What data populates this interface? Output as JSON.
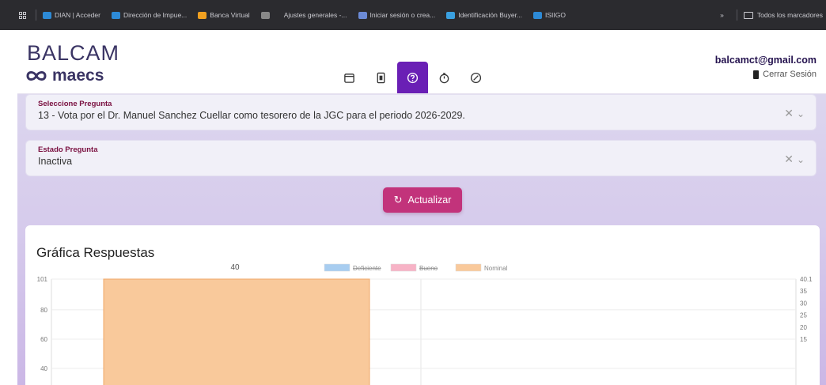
{
  "browser": {
    "bookmarks": [
      {
        "label": "DIAN | Acceder",
        "color": "#2d8ad6"
      },
      {
        "label": "Dirección de Impue...",
        "color": "#2d8ad6"
      },
      {
        "label": "Banca Virtual",
        "color": "#f0a020"
      },
      {
        "label": "",
        "color": "#888888"
      },
      {
        "label": "Ajustes generales -...",
        "color": ""
      },
      {
        "label": "Iniciar sesión o crea...",
        "color": "#6b8ad6"
      },
      {
        "label": "Identificación Buyer...",
        "color": "#3aa0e0"
      },
      {
        "label": "ISIIGO",
        "color": "#2d8ad6"
      }
    ],
    "more_label": "»",
    "all_bookmarks_label": "Todos los marcadores"
  },
  "header": {
    "brand_top": "BALCAM",
    "brand_bottom": "maecs",
    "user_email": "balcamct@gmail.com",
    "logout_label": "Cerrar Sesión",
    "nav_tabs": [
      {
        "icon": "calendar-icon",
        "active": false
      },
      {
        "icon": "document-icon",
        "active": false
      },
      {
        "icon": "question-icon",
        "active": true
      },
      {
        "icon": "timer-icon",
        "active": false
      },
      {
        "icon": "cancel-icon",
        "active": false
      }
    ]
  },
  "form": {
    "question_label": "Seleccione Pregunta",
    "question_value": "13 - Vota por el Dr. Manuel Sanchez Cuellar como tesorero de la JGC para el periodo 2026-2029.",
    "status_label": "Estado Pregunta",
    "status_value": "Inactiva",
    "refresh_label": "Actualizar"
  },
  "chart_card": {
    "title": "Gráfica Respuestas"
  },
  "chart_data": {
    "type": "bar",
    "data_label": "40",
    "legend": [
      {
        "name": "Deficiente",
        "color": "#a8cdf0",
        "hidden": true
      },
      {
        "name": "Bueno",
        "color": "#f7b3c6",
        "hidden": true
      },
      {
        "name": "Nominal",
        "color": "#f9c99b",
        "hidden": false
      }
    ],
    "series": [
      {
        "name": "Nominal",
        "values": [
          40
        ]
      }
    ],
    "y_left": {
      "ticks": [
        "101",
        "80",
        "60",
        "40"
      ],
      "min": 31,
      "max": 101
    },
    "y_right": {
      "ticks": [
        "40.1",
        "35",
        "30",
        "25",
        "20",
        "15"
      ],
      "min": 11,
      "max": 40.1
    }
  }
}
